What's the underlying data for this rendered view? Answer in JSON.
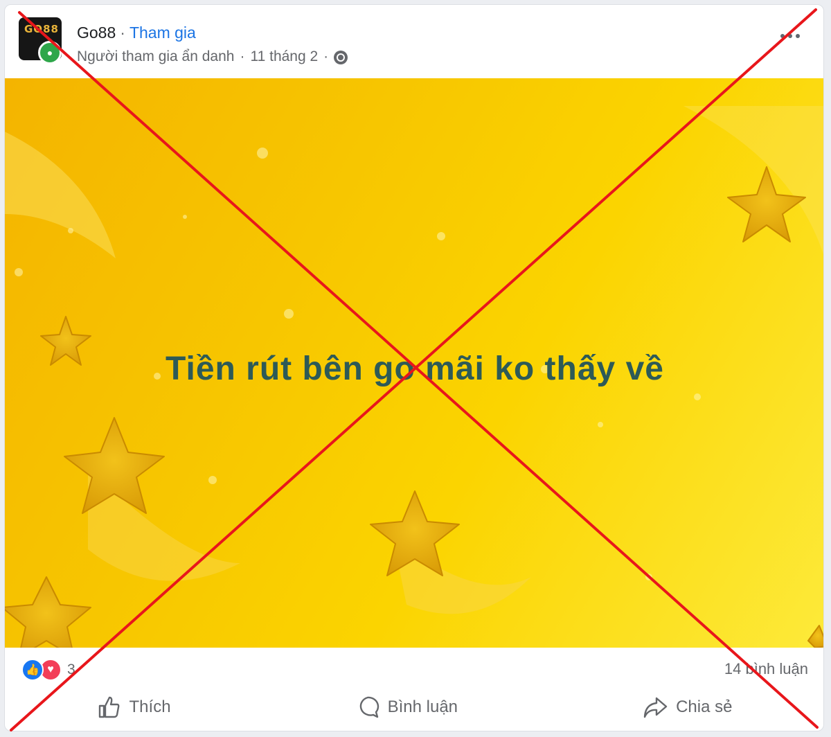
{
  "header": {
    "group_name": "Go88",
    "separator": "·",
    "join_label": "Tham gia",
    "author": "Người tham gia ẩn danh",
    "date": "11 tháng 2",
    "avatar_text": "GO88"
  },
  "media": {
    "caption": "Tiền rút bên go mãi ko thấy về"
  },
  "reactions": {
    "count": "3",
    "comments": "14 bình luận"
  },
  "actions": {
    "like": "Thích",
    "comment": "Bình luận",
    "share": "Chia sẻ"
  },
  "colors": {
    "join_link": "#1b74e4",
    "overlay_cross": "#e8161b",
    "caption": "#2d5a57"
  }
}
